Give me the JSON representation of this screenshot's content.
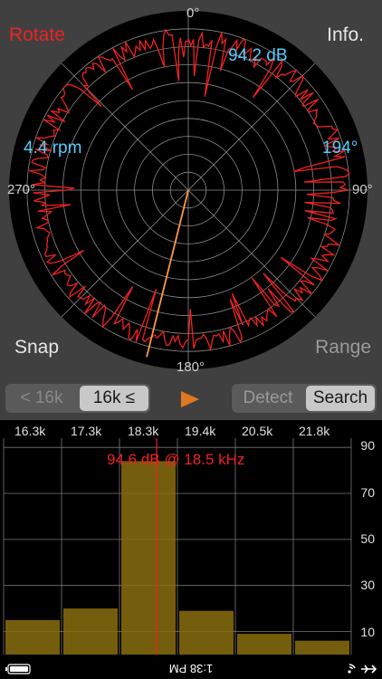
{
  "polar": {
    "rotate_label": "Rotate",
    "info_label": "Info.",
    "snap_label": "Snap",
    "range_label": "Range",
    "deg_0": "0°",
    "deg_90": "90°",
    "deg_180": "180°",
    "deg_270": "270°",
    "level_readout": "94.2 dB",
    "rpm_readout": "4.4 rpm",
    "angle_readout": "194°",
    "needle_angle_deg": 194,
    "colors": {
      "accent_red": "#ee2222",
      "readout_blue": "#55ccff",
      "needle": "#ff9944"
    }
  },
  "controls": {
    "low_filter_label": "< 16k",
    "high_filter_label": "16k ≤",
    "play_icon": "play-icon",
    "detect_label": "Detect",
    "search_label": "Search"
  },
  "spectrum": {
    "x_ticks": [
      "16.3k",
      "17.3k",
      "18.3k",
      "19.4k",
      "20.5k",
      "21.8k"
    ],
    "y_ticks": [
      "90",
      "70",
      "50",
      "30",
      "10"
    ],
    "peak_label": "94.6 dB @ 18.5 kHz",
    "bar_color": "#8a6d10"
  },
  "chart_data": {
    "type": "bar",
    "categories": [
      "16.3k",
      "17.3k",
      "18.3k",
      "19.4k",
      "20.5k",
      "21.8k"
    ],
    "values": [
      15,
      20,
      84,
      19,
      9,
      6
    ],
    "ylim": [
      0,
      94
    ],
    "peak_marker": "18.5 kHz"
  },
  "statusbar": {
    "time": "1:38 PM"
  }
}
